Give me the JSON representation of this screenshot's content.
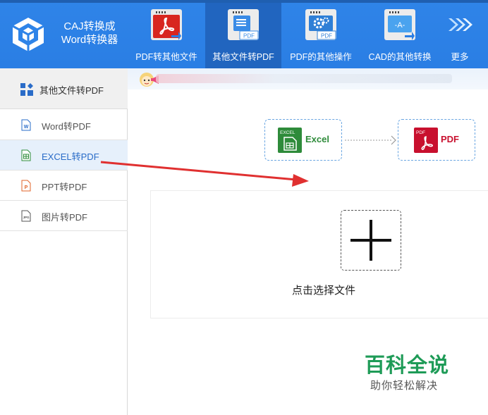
{
  "app": {
    "title_line1": "CAJ转换成",
    "title_line2": "Word转换器"
  },
  "nav": {
    "tabs": [
      {
        "label": "PDF转其他文件"
      },
      {
        "label": "其他文件转PDF"
      },
      {
        "label": "PDF的其他操作"
      },
      {
        "label": "CAD的其他转换"
      },
      {
        "label": "更多"
      }
    ],
    "tab1_icon_text": "PDF",
    "tab2_icon_text": "PDF",
    "tab3_icon_text": "-A-"
  },
  "sidebar": {
    "header_label": "其他文件转PDF",
    "items": [
      {
        "label": "Word转PDF"
      },
      {
        "label": "EXCEL转PDF"
      },
      {
        "label": "PPT转PDF"
      },
      {
        "label": "图片转PDF"
      }
    ],
    "jpg_icon_text": "JPG"
  },
  "main": {
    "source_format": "Excel",
    "source_icon_caption": "EXCEL",
    "target_format": "PDF",
    "target_icon_caption": "PDF",
    "add_label": "点击选择文件"
  },
  "watermark": {
    "main": "百科全说",
    "sub": "助你轻松解决"
  },
  "colors": {
    "header_blue": "#2f84e8",
    "active_tab": "#2165bf",
    "excel_green": "#2e8b3a",
    "pdf_red": "#c8102e",
    "arrow_red": "#e03030"
  }
}
